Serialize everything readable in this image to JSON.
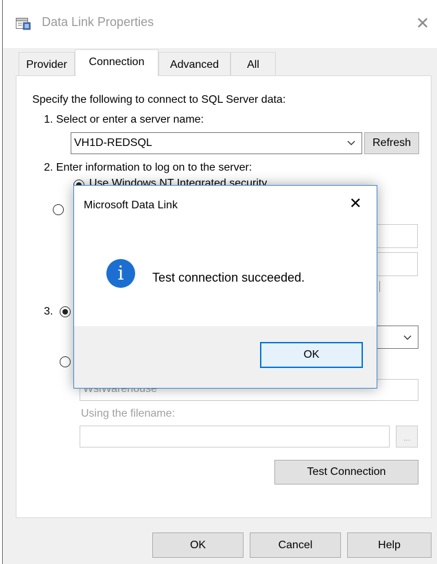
{
  "window": {
    "title": "Data Link Properties",
    "close_glyph": "✕"
  },
  "tabs": [
    {
      "label": "Provider",
      "active": false
    },
    {
      "label": "Connection",
      "active": true
    },
    {
      "label": "Advanced",
      "active": false
    },
    {
      "label": "All",
      "active": false
    }
  ],
  "connection": {
    "intro": "Specify the following to connect to SQL Server data:",
    "step1_label": "1. Select or enter a server name:",
    "server_name": "VH1D-REDSQL",
    "refresh_label": "Refresh",
    "step2_label": "2. Enter information to log on to the server:",
    "nt_security_label": "Use Windows NT Integrated security",
    "step3_prefix": "3.",
    "database_value": "WslWarehouse",
    "using_filename_label": "Using the filename:",
    "browse_label": "...",
    "test_connection_label": "Test Connection"
  },
  "footer": {
    "ok_label": "OK",
    "cancel_label": "Cancel",
    "help_label": "Help"
  },
  "message_box": {
    "title": "Microsoft Data Link",
    "close_glyph": "✕",
    "icon_glyph": "i",
    "message": "Test connection succeeded.",
    "ok_label": "OK"
  },
  "colors": {
    "accent": "#0078d7",
    "info_icon": "#1c6fd0",
    "dialog_border": "#3f8ad6"
  }
}
